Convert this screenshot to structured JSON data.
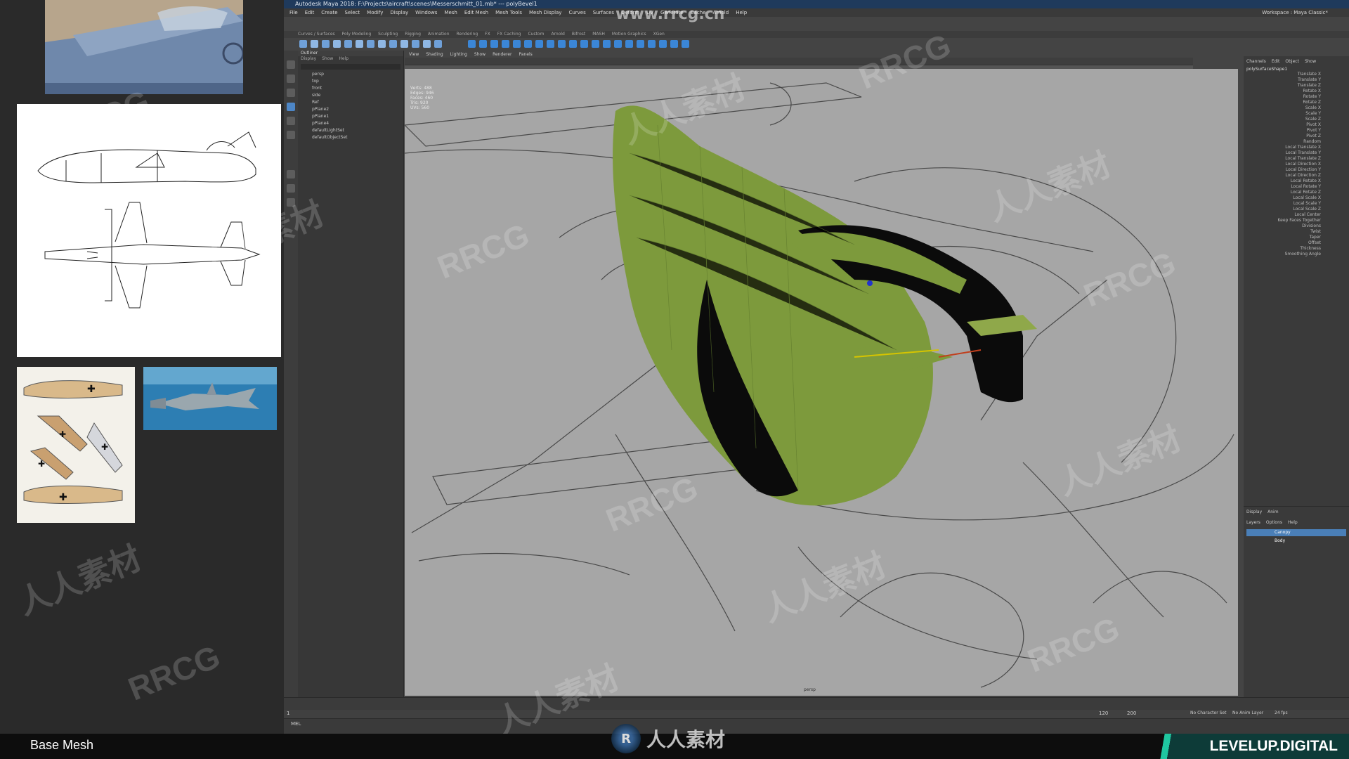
{
  "maya": {
    "title": "Autodesk Maya 2018: F:\\Projects\\aircraft\\scenes\\Messerschmitt_01.mb* --- polyBevel1",
    "menus": [
      "File",
      "Edit",
      "Create",
      "Select",
      "Modify",
      "Display",
      "Windows",
      "Mesh",
      "Edit Mesh",
      "Mesh Tools",
      "Mesh Display",
      "Curves",
      "Surfaces",
      "Deform",
      "UV",
      "Generate",
      "Cache",
      "Arnold",
      "Help"
    ],
    "workspace_label": "Workspace : Maya Classic*",
    "shelf_tabs": [
      "Curves / Surfaces",
      "Poly Modeling",
      "Sculpting",
      "Rigging",
      "Animation",
      "Rendering",
      "FX",
      "FX Caching",
      "Custom",
      "Arnold",
      "Bifrost",
      "MASH",
      "Motion Graphics",
      "XGen"
    ],
    "outliner": {
      "title": "Outliner",
      "menu": [
        "Display",
        "Show",
        "Help"
      ],
      "rows": [
        "persp",
        "top",
        "front",
        "side",
        "Ref",
        "pPlane2",
        "pPlane1",
        "pPlane4",
        "defaultLightSet",
        "defaultObjectSet"
      ]
    },
    "viewport": {
      "menu": [
        "View",
        "Shading",
        "Lighting",
        "Show",
        "Renderer",
        "Panels"
      ],
      "hud_labels": [
        "Verts:",
        "Edges:",
        "Faces:",
        "Tris:",
        "UVs:"
      ],
      "hud_values": [
        "488",
        "946",
        "460",
        "920",
        "560"
      ],
      "camera": "persp"
    },
    "channelbox": {
      "tabs": [
        "Channels",
        "Edit",
        "Object",
        "Show"
      ],
      "object": "polySurfaceShape1",
      "rows": [
        "Translate X",
        "Translate Y",
        "Translate Z",
        "Rotate X",
        "Rotate Y",
        "Rotate Z",
        "Scale X",
        "Scale Y",
        "Scale Z",
        "Pivot X",
        "Pivot Y",
        "Pivot Z",
        "Random",
        "Local Translate X",
        "Local Translate Y",
        "Local Translate Z",
        "Local Direction X",
        "Local Direction Y",
        "Local Direction Z",
        "Local Rotate X",
        "Local Rotate Y",
        "Local Rotate Z",
        "Local Scale X",
        "Local Scale Y",
        "Local Scale Z",
        "Local Center",
        "Keep Faces Together",
        "Divisions",
        "Twist",
        "Taper",
        "Offset",
        "Thickness",
        "Smoothing Angle"
      ],
      "layers_tabs": [
        "Display",
        "Anim"
      ],
      "layers_menu": [
        "Layers",
        "Options",
        "Help"
      ],
      "layers": [
        "Canopy",
        "Body"
      ]
    },
    "timeline": {
      "start": "1",
      "end": "120",
      "range_end": "200",
      "fps": "24 fps",
      "anim_layer": "No Anim Layer",
      "char_set": "No Character Set"
    },
    "cmd_label": "MEL"
  },
  "footer": {
    "label": "Base Mesh",
    "brand": "LEVELUP.DIGITAL"
  },
  "watermarks": {
    "url": "www.rrcg.cn",
    "rrcg": "RRCG",
    "cn": "人人素材"
  }
}
